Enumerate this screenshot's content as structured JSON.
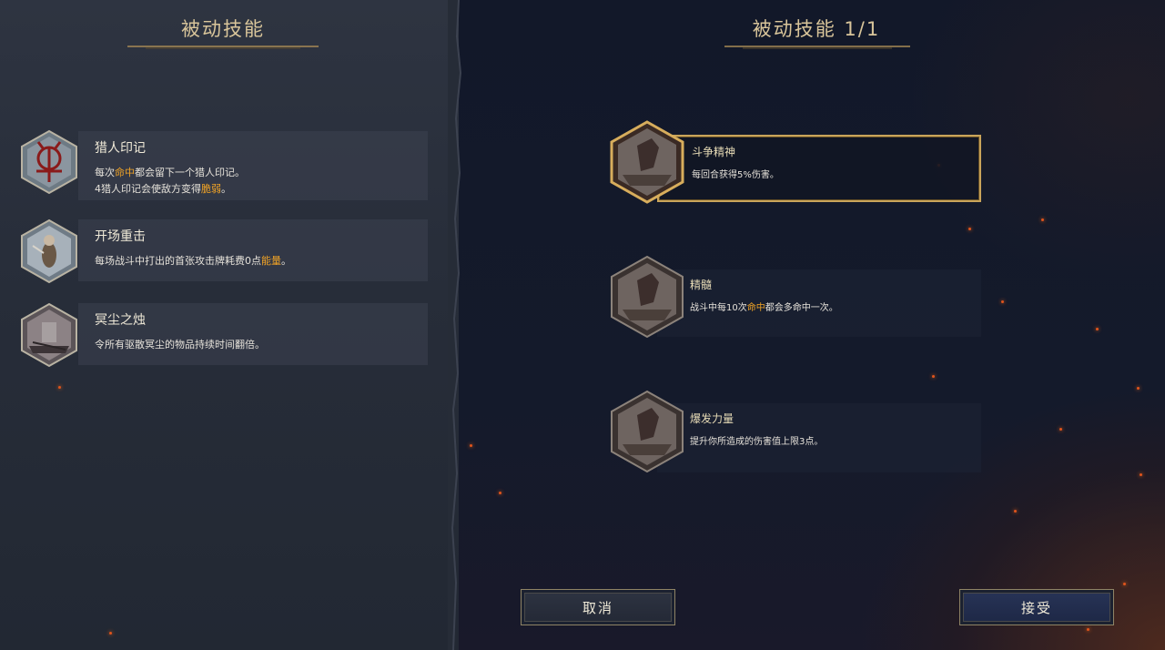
{
  "left": {
    "title": "被动技能",
    "skills": [
      {
        "name": "猎人印记",
        "desc1_a": "每次",
        "desc1_hl": "命中",
        "desc1_b": "都会留下一个猎人印记。",
        "desc2_a": "4猎人印记会使敌方变得",
        "desc2_hl": "脆弱",
        "desc2_b": "。",
        "icon": "hunter-mark-icon"
      },
      {
        "name": "开场重击",
        "desc1_a": "每场战斗中打出的首张攻击牌耗费0点",
        "desc1_hl": "能量",
        "desc1_b": "。",
        "icon": "opening-strike-icon"
      },
      {
        "name": "冥尘之烛",
        "desc1_a": "令所有驱散冥尘的物品持续时间翻倍。",
        "icon": "dust-candle-icon"
      }
    ]
  },
  "right": {
    "title": "被动技能 1/1",
    "choices": [
      {
        "name": "斗争精神",
        "desc_a": "每回合获得5%伤害。",
        "selected": true
      },
      {
        "name": "精髓",
        "desc_a": "战斗中每10次",
        "desc_hl": "命中",
        "desc_b": "都会多命中一次。",
        "selected": false
      },
      {
        "name": "爆发力量",
        "desc_a": "提升你所造成的伤害值上限3点。",
        "selected": false
      }
    ]
  },
  "buttons": {
    "cancel": "取消",
    "accept": "接受"
  },
  "colors": {
    "accent_gold": "#c9a45a",
    "highlight": "#f0a326",
    "left_bg": "#2b313d",
    "right_bg": "#131a2a"
  }
}
